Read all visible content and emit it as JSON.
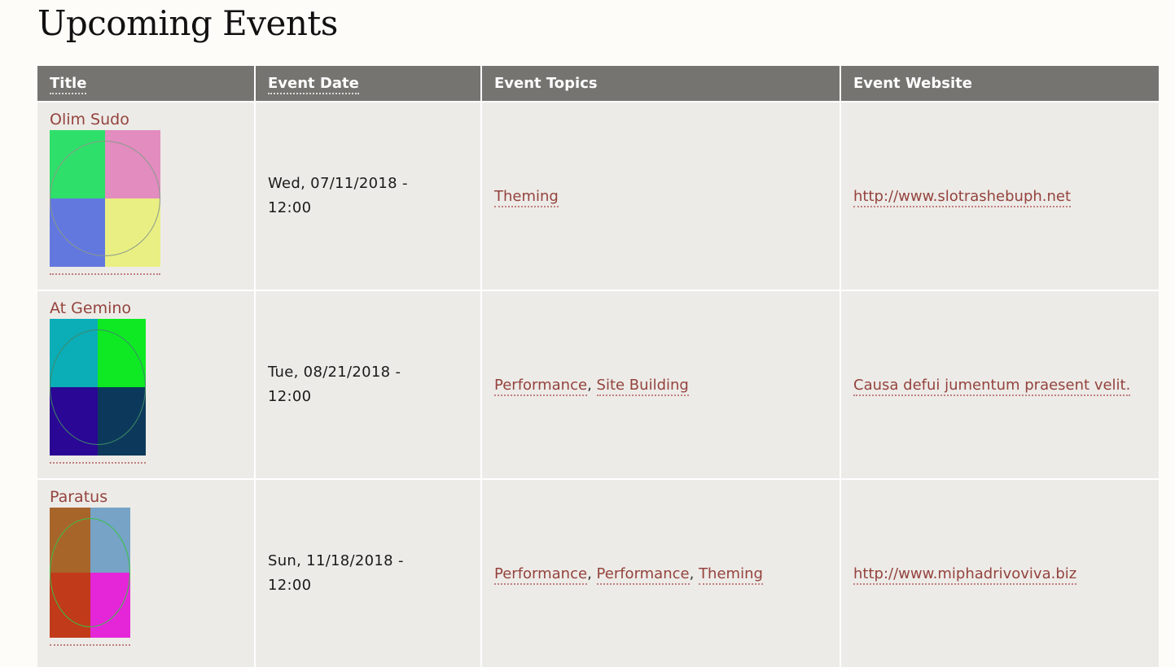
{
  "page": {
    "title": "Upcoming Events"
  },
  "table": {
    "headers": {
      "title": "Title",
      "date": "Event Date",
      "topics": "Event Topics",
      "website": "Event Website"
    },
    "rows": [
      {
        "title": "Olim Sudo",
        "image_colors": [
          "#2edf6a",
          "#e28cc0",
          "#6378df",
          "#e9ef82"
        ],
        "ring_color": "#8a9a8a",
        "date_line1": "Wed, 07/11/2018 -",
        "date_line2": "12:00",
        "topics": [
          "Theming"
        ],
        "website": "http://www.slotrashebuph.net"
      },
      {
        "title": "At Gemino",
        "image_colors": [
          "#0badb7",
          "#0ee923",
          "#2a0794",
          "#0c395b"
        ],
        "ring_color": "#3f8a6a",
        "date_line1": "Tue, 08/21/2018 -",
        "date_line2": "12:00",
        "topics": [
          "Performance",
          "Site Building"
        ],
        "website": "Causa defui jumentum praesent velit."
      },
      {
        "title": "Paratus",
        "image_colors": [
          "#a8652a",
          "#76a3c6",
          "#c13a19",
          "#e426d8"
        ],
        "ring_color": "#3bbf4a",
        "date_line1": "Sun, 11/18/2018 -",
        "date_line2": "12:00",
        "topics": [
          "Performance",
          "Performance",
          "Theming"
        ],
        "website": "http://www.miphadrivoviva.biz"
      }
    ]
  },
  "colors": {
    "header_bg": "#757470",
    "row_bg": "#edebe7",
    "link": "#94433e",
    "page_bg": "#fdfcf8"
  }
}
